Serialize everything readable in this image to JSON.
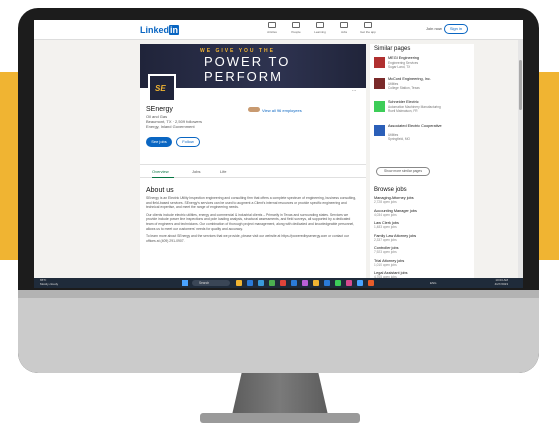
{
  "nav": {
    "logo_text": "Linked",
    "logo_in": "in",
    "items": [
      {
        "label": "Articles",
        "icon": "articles-icon"
      },
      {
        "label": "People",
        "icon": "people-icon"
      },
      {
        "label": "Learning",
        "icon": "learning-icon"
      },
      {
        "label": "Jobs",
        "icon": "jobs-icon"
      },
      {
        "label": "Get the app",
        "icon": "app-icon"
      }
    ],
    "join_label": "Join now",
    "signin_label": "Sign in"
  },
  "banner": {
    "tagline": "WE GIVE YOU THE",
    "line1": "POWER TO",
    "line2": "PERFORM",
    "more": "..."
  },
  "company": {
    "logo_text": "SE",
    "name": "SEnergy",
    "industry": "Oil and Gas",
    "meta": "Beaumont, TX  ·  2,509 followers",
    "link": "Energy, Inland Government",
    "employees": "View all 96 employees",
    "see_jobs": "See jobs",
    "follow": "Follow"
  },
  "tabs": [
    "Overview",
    "Jobs",
    "Life"
  ],
  "about": {
    "title": "About us",
    "paragraphs": [
      "SEnergy is an Electric Utility Inspection engineering and consulting firm that offers a complete spectrum of engineering, business consulting, and field-based services. SEnergy's services can be used to augment a Client's internal resources or provide specific engineering and technical expertise, and meet the range of engineering needs.",
      "Our clients include electric utilities, energy and commercial & industrial clients – Primarily in Texas and surrounding states. Services we provide include power line inspections and pole loading analysis, structural assessments, and field surveys, all supported by a dedicated team of engineers and technicians. Our combination of thorough project management, along with dedicated and knowledgeable personnel, allows us to meet our customers' needs for quality and accuracy.",
      "To learn more about SEnergy and the services that we provide, please visit our website at https://poweredbysenergy.com or contact our offices at (409) 291-0907."
    ],
    "website_label": "Website",
    "website_url": "https://poweredbysenergy.com"
  },
  "similar": {
    "title": "Similar pages",
    "items": [
      {
        "name": "MEGI Engineering",
        "line2": "Engineering Services",
        "line3": "Sugar Land, TX",
        "color": "#b03030"
      },
      {
        "name": "McCord Engineering, Inc.",
        "line2": "Utilities",
        "line3": "College Station, Texas",
        "color": "#7a2a2a"
      },
      {
        "name": "Schneider Electric",
        "line2": "Automation Machinery Manufacturing",
        "line3": "Rueil Malmaison, FR",
        "color": "#3dcd58"
      },
      {
        "name": "Associated Electric Cooperative",
        "line2": "Utilities",
        "line3": "Springfield, MO",
        "color": "#2b5fb8"
      }
    ],
    "show_more": "Show more similar pages"
  },
  "jobs": {
    "title": "Browse jobs",
    "items": [
      {
        "name": "Managing Attorney jobs",
        "count": "2,728 open jobs"
      },
      {
        "name": "Accounting Manager jobs",
        "count": "4,034 open jobs"
      },
      {
        "name": "Law Clerk jobs",
        "count": "1,483 open jobs"
      },
      {
        "name": "Family Law Attorney jobs",
        "count": "2,337 open jobs"
      },
      {
        "name": "Controller jobs",
        "count": "7,923 open jobs"
      },
      {
        "name": "Trial Attorney jobs",
        "count": "1,010 open jobs"
      },
      {
        "name": "Legal Assistant jobs",
        "count": "4,705 open jobs"
      },
      {
        "name": "Attorney jobs",
        "count": "11,251 open jobs"
      }
    ]
  },
  "taskbar": {
    "weather_temp": "65°F",
    "weather_text": "Mostly cloudy",
    "search_label": "Search",
    "app_colors": [
      "#f0b432",
      "#2b7bd8",
      "#3a9ad9",
      "#4caf50",
      "#e0443a",
      "#2b7bd8",
      "#b85fd6",
      "#f0b432",
      "#2b7bd8",
      "#3dcd58",
      "#d84a8e",
      "#4aa3ff",
      "#e85d2a"
    ],
    "time": "10:03 AM",
    "date": "4/27/2023",
    "tray": "ENG"
  }
}
